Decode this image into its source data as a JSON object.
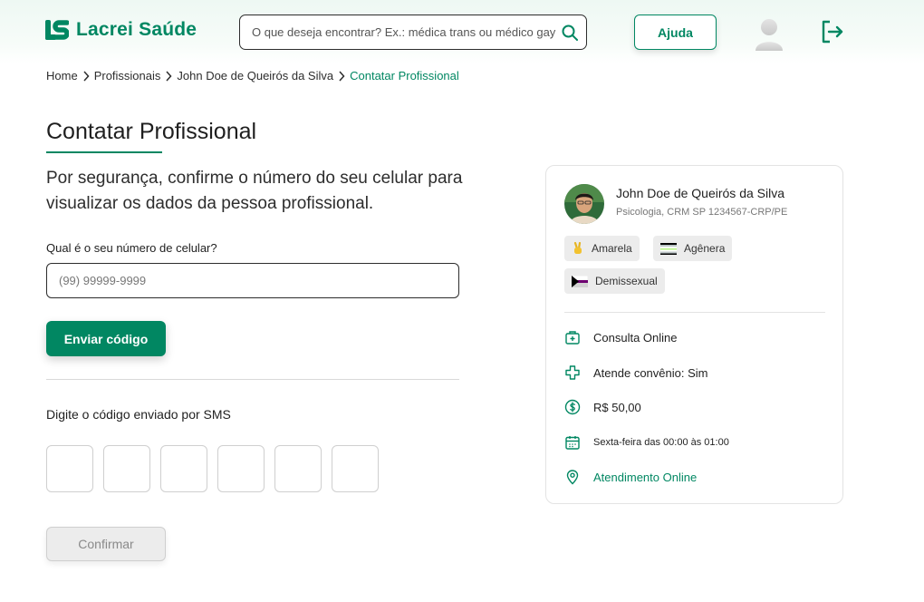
{
  "header": {
    "logo_text": "Lacrei Saúde",
    "search_placeholder": "O que deseja encontrar? Ex.: médica trans ou médico gay",
    "help_label": "Ajuda"
  },
  "breadcrumb": [
    "Home",
    "Profissionais",
    "John Doe de Queirós da Silva",
    "Contatar Profissional"
  ],
  "main": {
    "title": "Contatar Profissional",
    "intro": "Por segurança, confirme o número do seu celular para visualizar os dados da pessoa profissional.",
    "phone_label": "Qual é o seu número de celular?",
    "phone_placeholder": "(99) 99999-9999",
    "send_label": "Enviar código",
    "sms_label": "Digite o código enviado por SMS",
    "code_boxes": 6,
    "confirm_label": "Confirmar"
  },
  "card": {
    "name": "John Doe de Queirós da Silva",
    "subtitle": "Psicologia, CRM SP 1234567-CRP/PE",
    "tags": [
      "Amarela",
      "Agênera",
      "Demissexual"
    ],
    "info": [
      {
        "icon": "online-consultation-icon",
        "text": "Consulta Online"
      },
      {
        "icon": "health-cross-icon",
        "text": "Atende convênio: Sim"
      },
      {
        "icon": "dollar-icon",
        "text": "R$ 50,00"
      },
      {
        "icon": "calendar-icon",
        "text": "Sexta-feira das 00:00 às 01:00"
      },
      {
        "icon": "location-pin-icon",
        "text": "Atendimento Online"
      }
    ]
  },
  "colors": {
    "brand": "#018762",
    "text": "#2d2d2d",
    "disabled_bg": "#ececec"
  }
}
